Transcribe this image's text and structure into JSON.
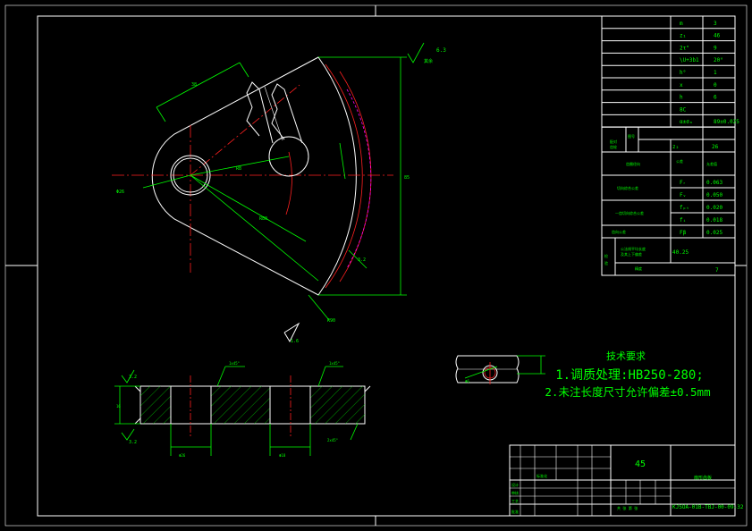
{
  "params": {
    "rows": [
      {
        "sym": "m",
        "val": "3"
      },
      {
        "sym": "z₁",
        "val": "46"
      },
      {
        "sym": "2τ°",
        "val": "9"
      },
      {
        "sym": "\\U+3b1",
        "val": "20°"
      },
      {
        "sym": "h°",
        "val": "1"
      },
      {
        "sym": "x",
        "val": "0"
      },
      {
        "sym": "h",
        "val": "6"
      },
      {
        "sym": "8C",
        "val": ""
      },
      {
        "sym": "α±σₐ",
        "val": "89±0.025"
      }
    ],
    "pair": {
      "sym": "z₂",
      "val": "26"
    },
    "tol_rows": [
      {
        "sym": "Fᵣ",
        "val": "0.063"
      },
      {
        "sym": "Fᵥ",
        "val": "0.050"
      },
      {
        "sym": "fₚₜ",
        "val": "0.020"
      },
      {
        "sym": "fᵢ",
        "val": "0.018"
      },
      {
        "sym": "Fβ",
        "val": "0.025"
      }
    ],
    "measure": "40.25",
    "last": "7"
  },
  "notes": {
    "title": "技术要求",
    "line1": "1.调质处理:HB250-280;",
    "line2": "2.未注长度尺寸允许偏差±0.5mm"
  },
  "titleblock": {
    "material": "45",
    "drawing_no": "KJSOA-01B-TBJ-00-09-32"
  },
  "dims": {
    "top_roughness": "6.3",
    "left_roughness": "3.2",
    "bottom_roughness": "1.6",
    "right_roughness": "3.2"
  }
}
